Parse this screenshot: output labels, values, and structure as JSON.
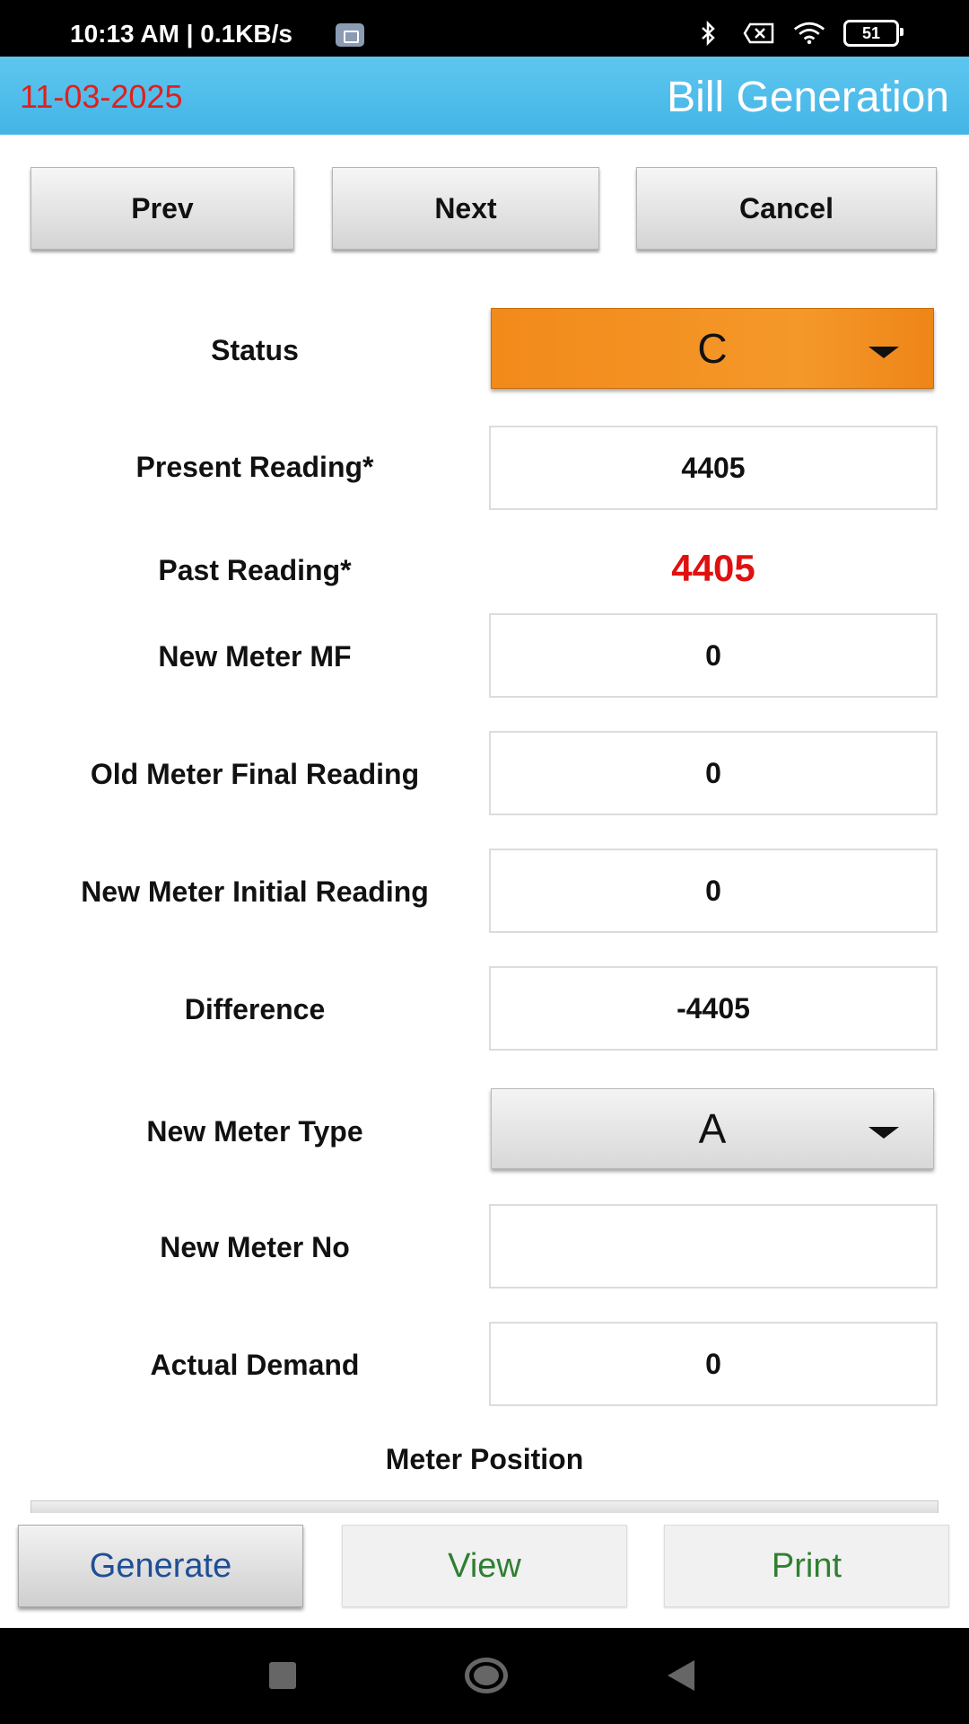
{
  "status_bar": {
    "time": "10:13 AM | 0.1KB/s",
    "battery": "51",
    "icons": [
      "image-notification-icon",
      "bluetooth-icon",
      "sim-off-icon",
      "wifi-icon",
      "battery-icon"
    ]
  },
  "header": {
    "date": "11-03-2025",
    "title": "Bill Generation",
    "date_color": "#e0201e",
    "bar_color": "#4fbdea"
  },
  "nav_buttons": {
    "prev": "Prev",
    "next": "Next",
    "cancel": "Cancel"
  },
  "form": {
    "status": {
      "label": "Status",
      "value": "C",
      "color": "#f28a1a"
    },
    "present_reading": {
      "label": "Present Reading*",
      "value": "4405"
    },
    "past_reading": {
      "label": "Past Reading*",
      "value": "4405",
      "color": "#e01010"
    },
    "new_meter_mf": {
      "label": "New Meter MF",
      "value": "0"
    },
    "old_meter_final_reading": {
      "label": "Old Meter Final Reading",
      "value": "0"
    },
    "new_meter_initial_reading": {
      "label": "New Meter Initial Reading",
      "value": "0"
    },
    "difference": {
      "label": "Difference",
      "value": "-4405"
    },
    "new_meter_type": {
      "label": "New Meter Type",
      "value": "A"
    },
    "new_meter_no": {
      "label": "New Meter No",
      "value": ""
    },
    "actual_demand": {
      "label": "Actual Demand",
      "value": "0"
    },
    "meter_position": {
      "label": "Meter Position"
    }
  },
  "actions": {
    "generate": "Generate",
    "view": "View",
    "print": "Print",
    "generate_color": "#1f4e96",
    "view_print_color": "#2f7f31"
  }
}
